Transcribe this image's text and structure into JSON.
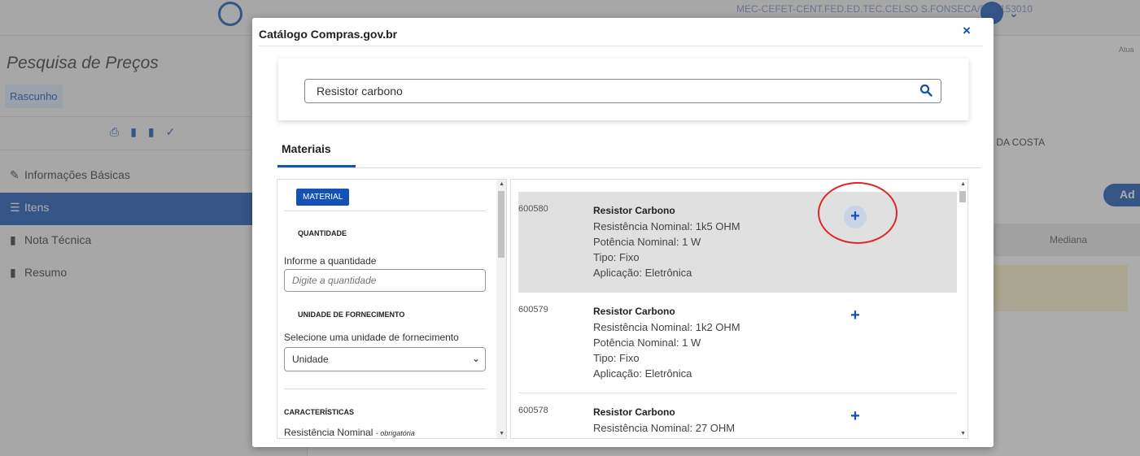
{
  "background": {
    "org_text": "MEC-CEFET-CENT.FED.ED.TEC.CELSO S.FONSECA/RJ | 153010",
    "page_title": "Pesquisa de Preços",
    "status_badge": "Rascunho",
    "nav": [
      {
        "label": "Informações Básicas",
        "icon": "pencil-icon"
      },
      {
        "label": "Itens",
        "icon": "list-icon"
      },
      {
        "label": "Nota Técnica",
        "icon": "file-icon"
      },
      {
        "label": "Resumo",
        "icon": "file-icon"
      }
    ],
    "right_atua": "Atua",
    "right_name": "HA DA COSTA",
    "right_add_button": "Ad",
    "right_column_header": "Mediana"
  },
  "modal": {
    "title": "Catálogo Compras.gov.br",
    "close_label": "×",
    "search": {
      "value": "Resistor carbono",
      "placeholder": ""
    },
    "tab_label": "Materiais",
    "filters": {
      "material_button": "MATERIAL",
      "quantity_heading": "QUANTIDADE",
      "quantity_label": "Informe a quantidade",
      "quantity_placeholder": "Digite a quantidade",
      "unit_heading": "UNIDADE DE FORNECIMENTO",
      "unit_label": "Selecione uma unidade de fornecimento",
      "unit_selected": "Unidade",
      "characteristics_heading": "CARACTERÍSTICAS",
      "resistance_label": "Resistência Nominal",
      "resistance_required": "- obrigatória"
    },
    "results": [
      {
        "code": "600580",
        "title": "Resistor Carbono",
        "resistance": "Resistência Nominal: 1k5 OHM",
        "power": "Potência Nominal: 1 W",
        "type": "Tipo: Fixo",
        "application": "Aplicação: Eletrônica",
        "add_label": "+"
      },
      {
        "code": "600579",
        "title": "Resistor Carbono",
        "resistance": "Resistência Nominal: 1k2 OHM",
        "power": "Potência Nominal: 1 W",
        "type": "Tipo: Fixo",
        "application": "Aplicação: Eletrônica",
        "add_label": "+"
      },
      {
        "code": "600578",
        "title": "Resistor Carbono",
        "resistance": "Resistência Nominal: 27 OHM",
        "add_label": "+"
      }
    ]
  },
  "colors": {
    "accent": "#1351b4",
    "annotation": "#e0252a",
    "highlight_row": "#e0e0e0"
  }
}
